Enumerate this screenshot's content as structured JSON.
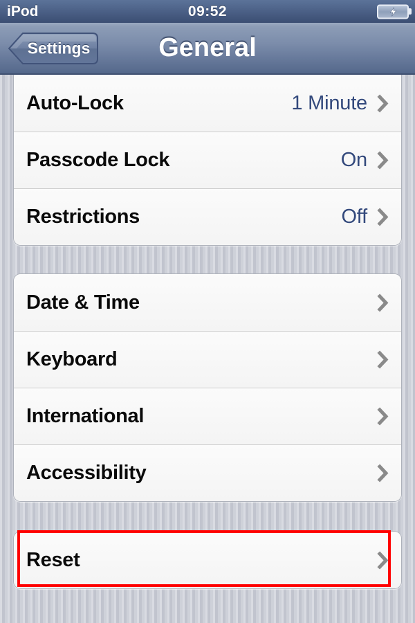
{
  "status_bar": {
    "carrier": "iPod",
    "time": "09:52",
    "battery_icon": "battery-charging-icon"
  },
  "nav_bar": {
    "back_label": "Settings",
    "title": "General"
  },
  "colors": {
    "status_bar_bg": "#4d6288",
    "nav_bar_bg": "#7c8dab",
    "row_bg": "#f7f7f7",
    "value_text": "#33497c",
    "label_text": "#0a0a0a",
    "chevron": "#8a8a8a",
    "page_bg": "#c9ccd5",
    "highlight": "#ff0000"
  },
  "groups": [
    {
      "id": "group-lock",
      "rows": [
        {
          "label": "Auto-Lock",
          "value": "1 Minute",
          "chevron": "chevron-right-icon"
        },
        {
          "label": "Passcode Lock",
          "value": "On",
          "chevron": "chevron-right-icon"
        },
        {
          "label": "Restrictions",
          "value": "Off",
          "chevron": "chevron-right-icon"
        }
      ]
    },
    {
      "id": "group-system",
      "rows": [
        {
          "label": "Date & Time",
          "value": "",
          "chevron": "chevron-right-icon"
        },
        {
          "label": "Keyboard",
          "value": "",
          "chevron": "chevron-right-icon"
        },
        {
          "label": "International",
          "value": "",
          "chevron": "chevron-right-icon"
        },
        {
          "label": "Accessibility",
          "value": "",
          "chevron": "chevron-right-icon"
        }
      ]
    },
    {
      "id": "group-reset",
      "rows": [
        {
          "label": "Reset",
          "value": "",
          "chevron": "chevron-right-icon"
        }
      ]
    }
  ],
  "annotation": {
    "type": "rectangle-highlight",
    "target": "Reset",
    "color": "#ff0000"
  }
}
